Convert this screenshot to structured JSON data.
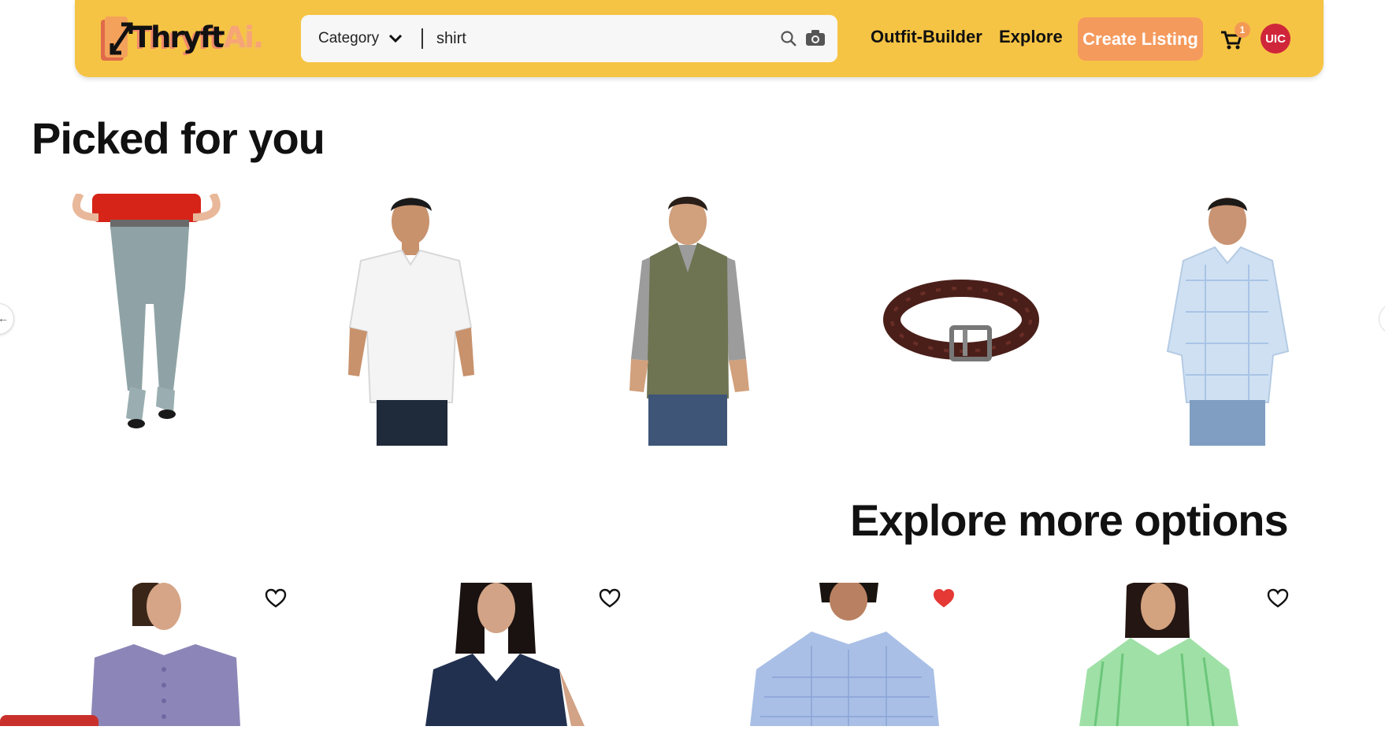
{
  "header": {
    "logo": {
      "text_main": "Thryft",
      "text_accent": "Ai."
    },
    "search": {
      "category_label": "Category",
      "query": "shirt"
    },
    "nav": {
      "outfit_builder": "Outfit-Builder",
      "explore": "Explore"
    },
    "create_listing": "Create Listing",
    "cart_count": "1",
    "avatar_initials": "UIC"
  },
  "picked": {
    "title": "Picked for you",
    "items": [
      {
        "icon": "jeans-woman"
      },
      {
        "icon": "white-shirt-man"
      },
      {
        "icon": "olive-vest-man"
      },
      {
        "icon": "brown-belt"
      },
      {
        "icon": "blue-check-shirt-man"
      }
    ]
  },
  "explore": {
    "title": "Explore more options",
    "items": [
      {
        "icon": "purple-blouse-woman",
        "favorited": false
      },
      {
        "icon": "navy-top-woman",
        "favorited": false
      },
      {
        "icon": "blue-shirt-man",
        "favorited": true
      },
      {
        "icon": "green-stripe-shirt-woman",
        "favorited": false
      }
    ]
  },
  "colors": {
    "header_bg": "#f6c444",
    "create_button": "#f59a5d",
    "avatar": "#d0263a",
    "heart_active": "#e53935"
  }
}
